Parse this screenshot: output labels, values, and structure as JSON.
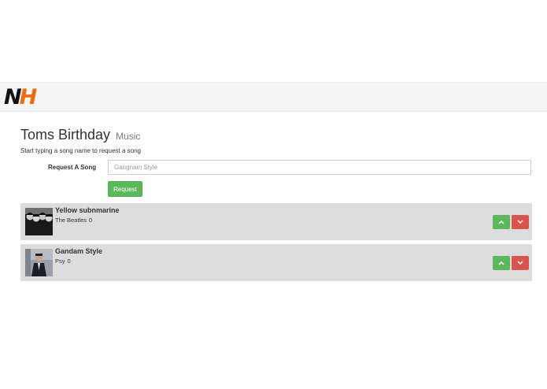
{
  "brand": {
    "logo_n": "N",
    "logo_h": "H",
    "logo_color": "#f06a13"
  },
  "page": {
    "title": "Toms Birthday",
    "subtitle": "Music"
  },
  "request": {
    "hint": "Start typing a song name to request a song",
    "label": "Request A Song",
    "placeholder": "Gangnam Style",
    "button_label": "Request"
  },
  "songs": [
    {
      "title": "Yellow subnmarine",
      "artist": "The Beatles",
      "votes": "0",
      "thumb": "beatles-album-art"
    },
    {
      "title": "Gandam Style",
      "artist": "Psy",
      "votes": "0",
      "thumb": "psy-album-art"
    }
  ],
  "icons": {
    "upvote": "chevron-up-icon",
    "downvote": "chevron-down-icon"
  },
  "colors": {
    "upvote": "#5cb85c",
    "downvote": "#d9534f",
    "song_bg": "#dddddd",
    "navbar_bg": "#f5f5f5"
  }
}
